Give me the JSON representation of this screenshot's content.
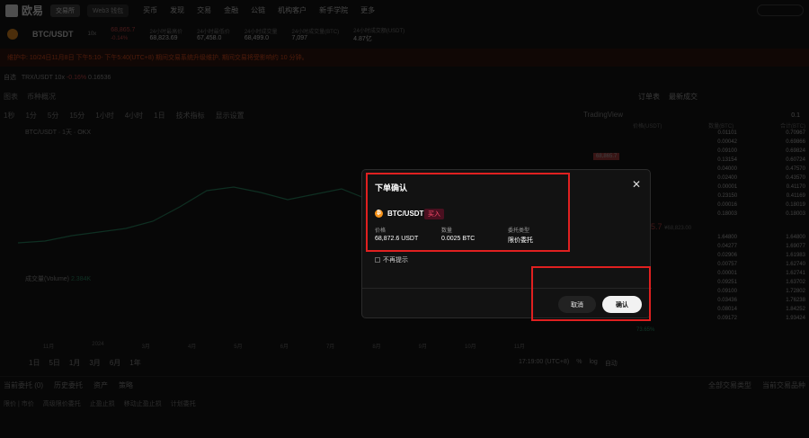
{
  "topbar": {
    "brand": "欧易",
    "mode_tabs": [
      "交易所",
      "Web3 钱包"
    ],
    "nav": [
      "买币",
      "发现",
      "交易",
      "金融",
      "公链",
      "机构客户",
      "新手学院",
      "更多"
    ]
  },
  "ticker": {
    "pair": "BTC/USDT",
    "leverage": "10x",
    "price": "68,865.7",
    "change": "-0.14%",
    "stats": [
      {
        "label": "24小时最高价",
        "value": "68,823.69"
      },
      {
        "label": "24小时最低价",
        "value": "67,458.0"
      },
      {
        "label": "24小时成交量",
        "value": "68,499.0"
      },
      {
        "label": "24小时成交量(BTC)",
        "value": "7,097"
      },
      {
        "label": "24小时成交额(USDT)",
        "value": "4.87亿"
      }
    ]
  },
  "banner": {
    "text": "维护中: 10/24日11月8日 下午5:10- 下午5:40(UTC+8) 期间交易系统升级维护, 期间交易将受影响约 10 分钟。"
  },
  "subbar": {
    "label": "自选",
    "pair": "TRX/USDT 10x",
    "change": "-0.16%",
    "price": "0.16536"
  },
  "chart": {
    "tabs": [
      "图表",
      "币种概况"
    ],
    "intervals": [
      "1秒",
      "1分",
      "5分",
      "15分",
      "1小时",
      "4小时",
      "1日"
    ],
    "indicators": "技术指标",
    "display": "显示设置",
    "trading_view": "TradingView",
    "legend": "BTC/USDT · 1天 · OKX",
    "volume_label": "成交量(Volume)",
    "volume_value": "2.384K",
    "price_tag": "68,865.7",
    "x_ticks": [
      "11月",
      "2024",
      "3月",
      "4月",
      "5月",
      "6月",
      "7月",
      "8月",
      "9月",
      "10月",
      "11月"
    ],
    "ranges": [
      "1日",
      "5日",
      "1月",
      "3月",
      "6月",
      "1年"
    ],
    "time": "17:19:00 (UTC+8)",
    "scale_opts": [
      "%",
      "log",
      "自动"
    ]
  },
  "orderbook": {
    "tabs": [
      "订单表",
      "最新成交"
    ],
    "step": "0.1",
    "headers": [
      "价格(USDT)",
      "数量(BTC)",
      "合计(BTC)"
    ],
    "asks": [
      {
        "qty": "0.01101",
        "total": "0.70967"
      },
      {
        "qty": "0.00042",
        "total": "0.69866"
      },
      {
        "qty": "0.09100",
        "total": "0.69824"
      },
      {
        "qty": "0.13154",
        "total": "0.60724"
      },
      {
        "qty": "0.04000",
        "total": "0.47570"
      },
      {
        "qty": "0.02400",
        "total": "0.43570"
      },
      {
        "qty": "0.00001",
        "total": "0.41170"
      },
      {
        "qty": "0.23150",
        "total": "0.41169"
      },
      {
        "qty": "0.00016",
        "total": "0.18019"
      },
      {
        "qty": "0.18003",
        "total": "0.18003"
      }
    ],
    "mid_price": "68865.7",
    "mid_sub": "¥68,823.00",
    "bids": [
      {
        "qty": "1.64800",
        "total": "1.64800"
      },
      {
        "qty": "0.04277",
        "total": "1.69077"
      },
      {
        "qty": "0.02906",
        "total": "1.61983"
      },
      {
        "qty": "0.00757",
        "total": "1.62740"
      },
      {
        "qty": "0.00001",
        "total": "1.62741"
      },
      {
        "qty": "0.09251",
        "total": "1.63702"
      },
      {
        "qty": "0.09100",
        "total": "1.72802"
      },
      {
        "qty": "0.03436",
        "total": "1.76238"
      },
      {
        "qty": "0.08014",
        "total": "1.84252"
      },
      {
        "qty": "0.09172",
        "total": "1.93424"
      }
    ],
    "buy_ratio": "73.65%"
  },
  "bottom": {
    "tabs": [
      "当前委托 (0)",
      "历史委托",
      "资产",
      "策略"
    ],
    "filter": "全部交易类型",
    "current_only": "当前交易品种",
    "sub_tabs": [
      "限价 | 市价",
      "高级限价委托",
      "止盈止损",
      "移动止盈止损",
      "计划委托"
    ]
  },
  "modal": {
    "title": "下单确认",
    "pair": "BTC/USDT",
    "side": "买入",
    "fields": [
      {
        "label": "价格",
        "value": "68,872.6 USDT"
      },
      {
        "label": "数量",
        "value": "0.0025 BTC"
      },
      {
        "label": "委托类型",
        "value": "限价委托"
      }
    ],
    "dont_show": "不再提示",
    "cancel": "取消",
    "confirm": "确认"
  },
  "colors": {
    "up": "#2dbd85",
    "down": "#e34a4a",
    "highlight": "#e02020",
    "brand": "#f7931a"
  }
}
